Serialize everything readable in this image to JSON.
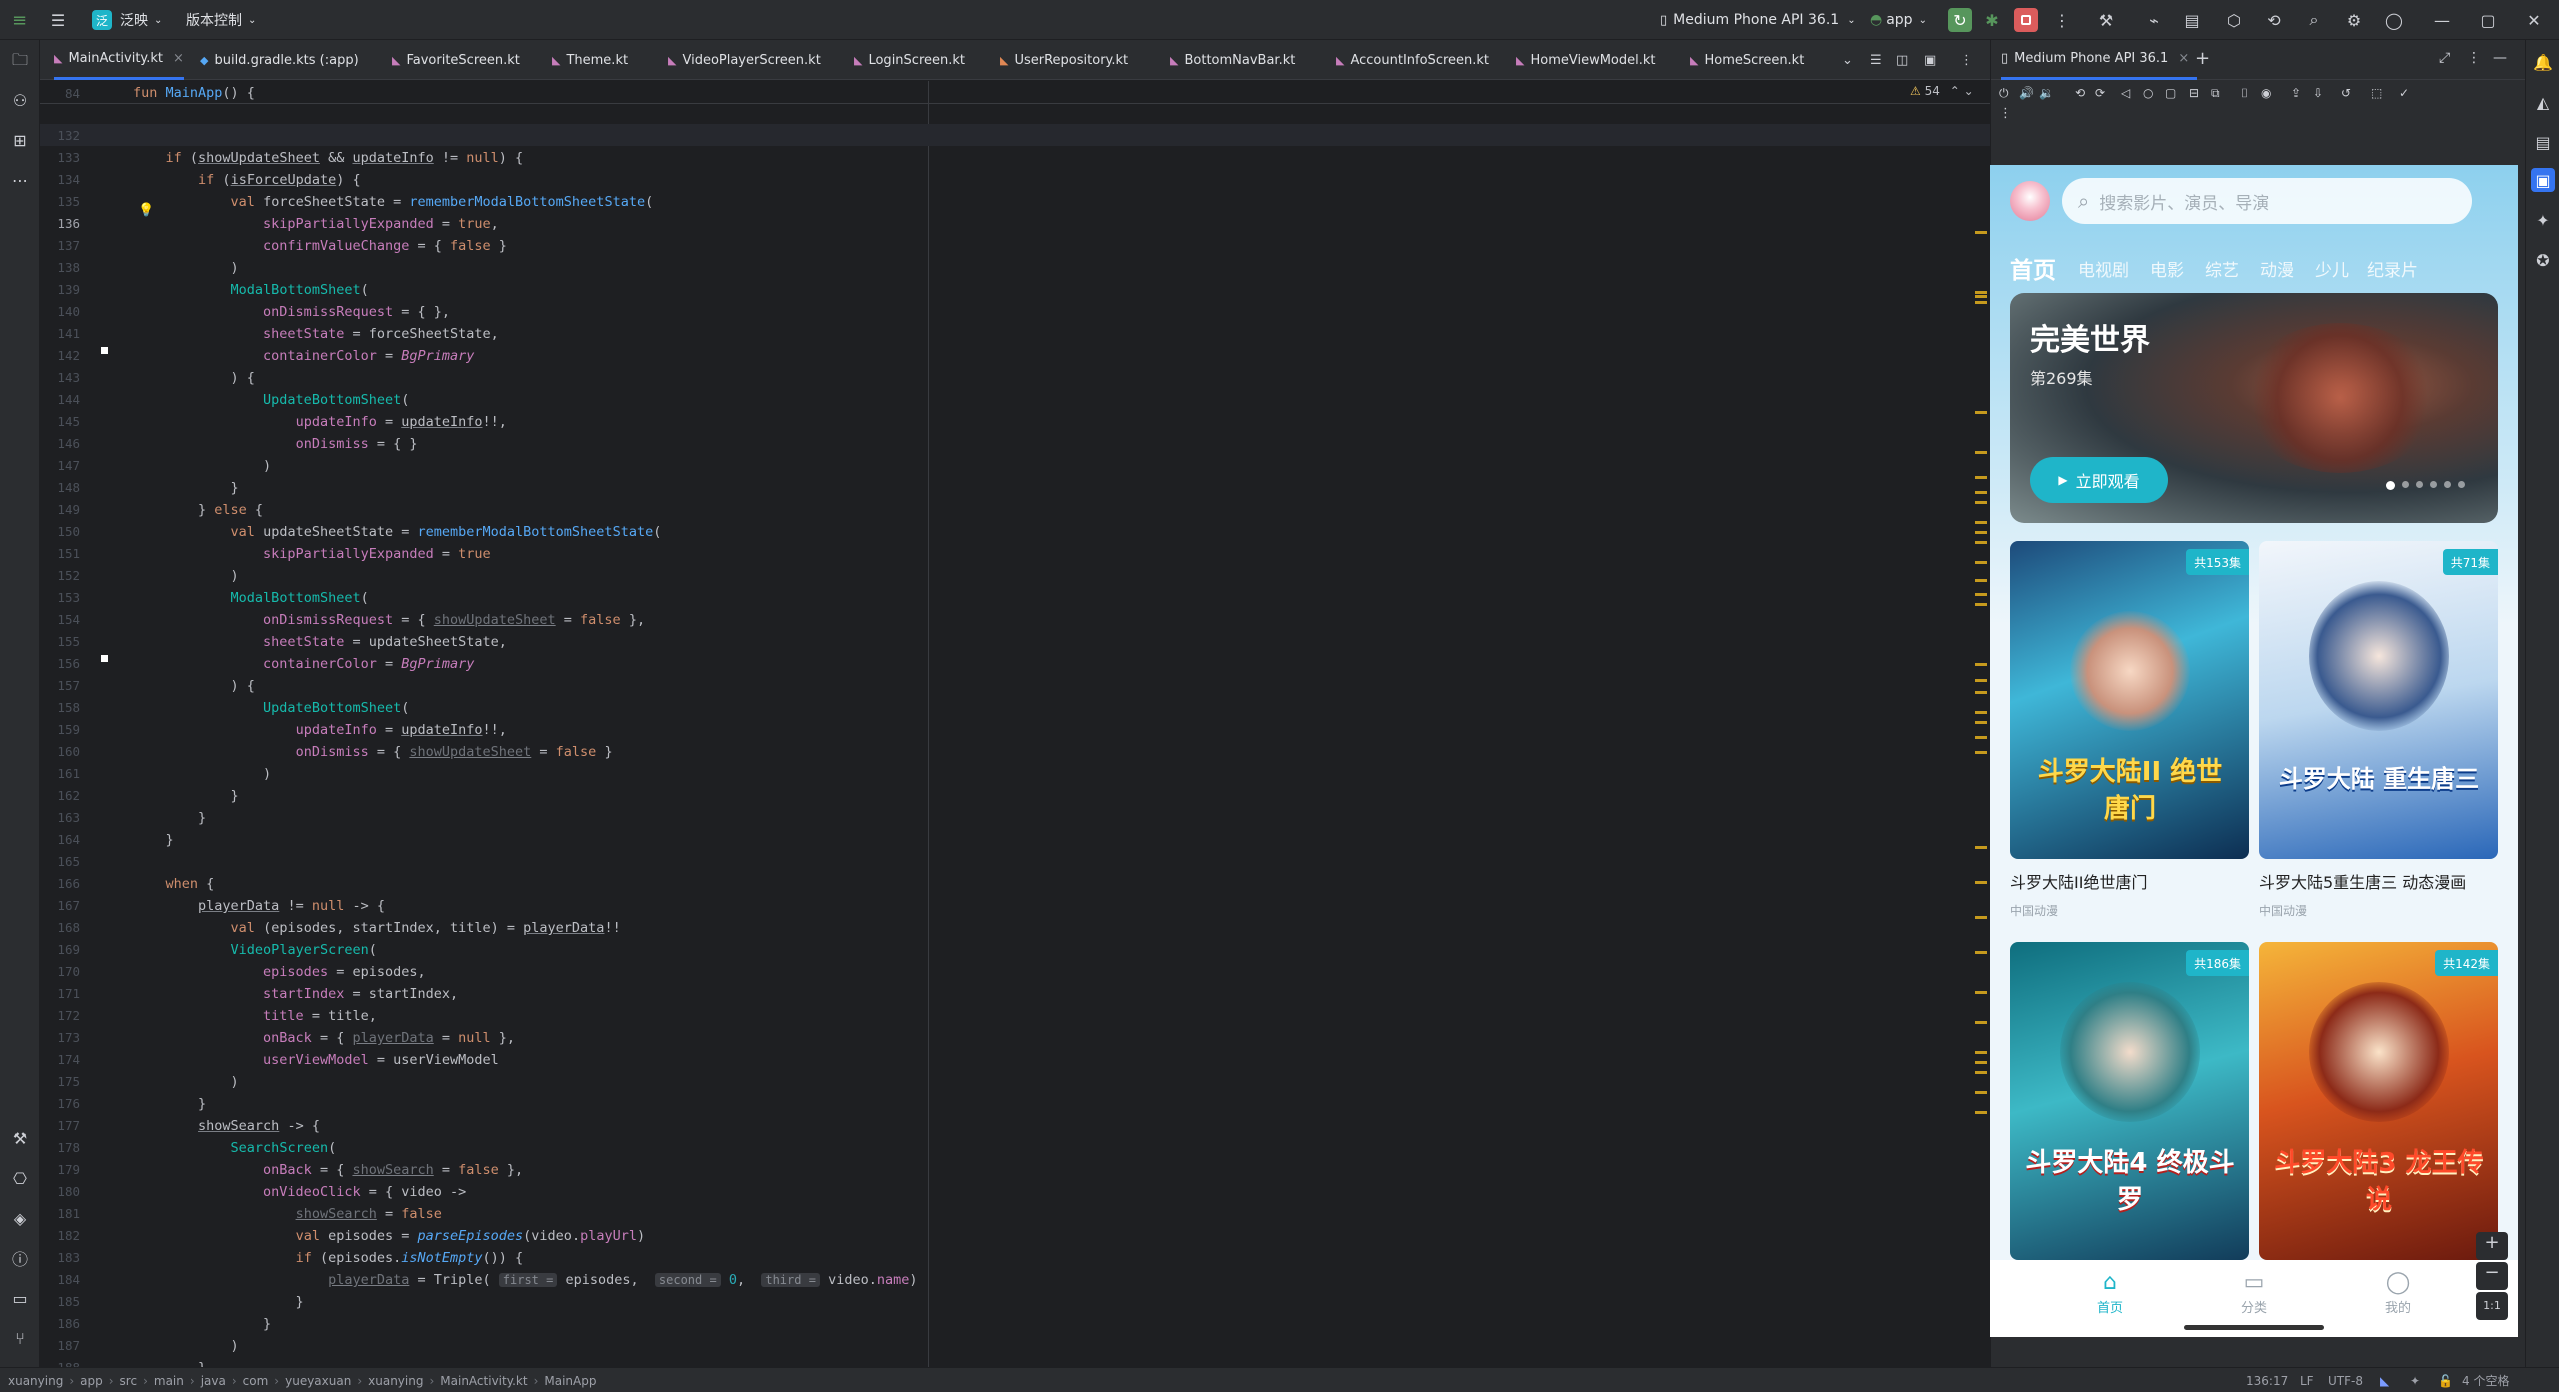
{
  "titlebar": {
    "project_badge": "泛",
    "project_name": "泛映",
    "vcs": "版本控制",
    "device": "Medium Phone API 36.1",
    "run_config": "app"
  },
  "tabs": [
    "MainActivity.kt",
    "build.gradle.kts (:app)",
    "FavoriteScreen.kt",
    "Theme.kt",
    "VideoPlayerScreen.kt",
    "LoginScreen.kt",
    "UserRepository.kt",
    "BottomNavBar.kt",
    "AccountInfoScreen.kt",
    "HomeViewModel.kt",
    "HomeScreen.kt"
  ],
  "editor": {
    "warnings_count": "54",
    "line_numbers": [
      "84",
      "132",
      "133",
      "134",
      "135",
      "136",
      "137",
      "138",
      "139",
      "140",
      "141",
      "142",
      "143",
      "144",
      "145",
      "146",
      "147",
      "148",
      "149",
      "150",
      "151",
      "152",
      "153",
      "154",
      "155",
      "156",
      "157",
      "158",
      "159",
      "160",
      "161",
      "162",
      "163",
      "164",
      "165",
      "166",
      "167",
      "168",
      "169",
      "170",
      "171",
      "172",
      "173",
      "174",
      "175",
      "176",
      "177",
      "178",
      "179",
      "180",
      "181",
      "182",
      "183",
      "184",
      "185",
      "186",
      "187",
      "188"
    ],
    "sticky_line": "fun MainApp() {"
  },
  "emulator": {
    "tab_title": "Medium Phone API 36.1",
    "zoom_label": "1:1"
  },
  "app": {
    "search_placeholder": "搜索影片、演员、导演",
    "categories": [
      "首页",
      "电视剧",
      "电影",
      "综艺",
      "动漫",
      "少儿",
      "纪录片"
    ],
    "banner": {
      "title": "完美世界",
      "subtitle": "第269集",
      "button": "立即观看"
    },
    "cards": [
      {
        "badge": "共153集",
        "title": "斗罗大陆II绝世唐门",
        "tag": "中国动漫",
        "art": "斗罗大陆II 绝世唐门"
      },
      {
        "badge": "共71集",
        "title": "斗罗大陆5重生唐三 动态漫画",
        "tag": "中国动漫",
        "art": "斗罗大陆 重生唐三"
      },
      {
        "badge": "共186集",
        "title": "",
        "tag": "",
        "art": "斗罗大陆4 终极斗罗"
      },
      {
        "badge": "共142集",
        "title": "",
        "tag": "",
        "art": "斗罗大陆3 龙王传说"
      }
    ],
    "nav": [
      {
        "label": "首页",
        "icon": "home-icon"
      },
      {
        "label": "分类",
        "icon": "tv-icon"
      },
      {
        "label": "我的",
        "icon": "profile-icon"
      }
    ]
  },
  "statusbar": {
    "breadcrumbs": [
      "xuanying",
      "app",
      "src",
      "main",
      "java",
      "com",
      "yueyaxuan",
      "xuanying",
      "MainActivity.kt",
      "MainApp"
    ],
    "position": "136:17",
    "line_sep": "LF",
    "encoding": "UTF-8",
    "indent": "4 个空格"
  },
  "colors": {
    "accent": "#3574f0",
    "app_primary": "#1fb5c9",
    "run_green": "#57965c",
    "stop_red": "#db5c5c"
  }
}
